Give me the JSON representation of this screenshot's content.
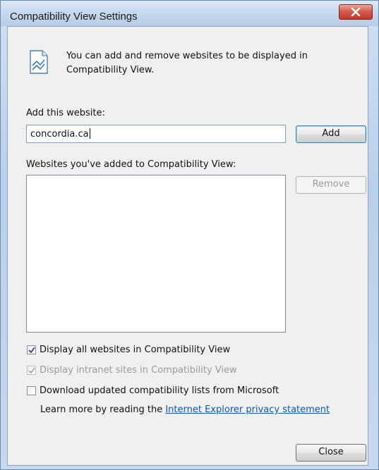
{
  "window": {
    "title": "Compatibility View Settings"
  },
  "info": {
    "text": "You can add and remove websites to be displayed in Compatibility View."
  },
  "add_section": {
    "label": "Add this website:",
    "input_value": "concordia.ca",
    "add_button": "Add"
  },
  "list_section": {
    "label": "Websites you've added to Compatibility View:",
    "items": [],
    "remove_button": "Remove"
  },
  "options": {
    "display_all": {
      "label": "Display all websites in Compatibility View",
      "checked": true
    },
    "display_intranet": {
      "label": "Display intranet sites in Compatibility View",
      "checked": true,
      "disabled": true
    },
    "download_lists": {
      "label": "Download updated compatibility lists from Microsoft",
      "checked": false
    }
  },
  "learn_more": {
    "prefix": "Learn more by reading the",
    "link_text": "Internet Explorer privacy statement"
  },
  "footer": {
    "close_button": "Close"
  }
}
